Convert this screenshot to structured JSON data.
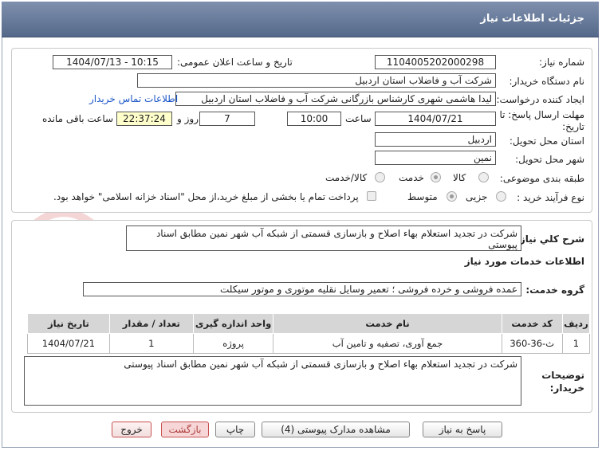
{
  "header": {
    "title": "جزئیات اطلاعات نیاز"
  },
  "form": {
    "need_number_label": "شماره نیاز:",
    "need_number": "1104005202000298",
    "announce_label": "تاریخ و ساعت اعلان عمومی:",
    "announce_value": "1404/07/13 - 10:15",
    "buyer_org_label": "نام دستگاه خریدار:",
    "buyer_org": "شرکت آب و فاضلاب استان اردبیل",
    "creator_label": "ایجاد کننده درخواست:",
    "creator": "لیدا  هاشمی شهری کارشناس بازرگانی شرکت آب و فاضلاب استان اردبیل",
    "contact_link": "اطلاعات تماس خریدار",
    "deadline_label_1": "مهلت ارسال پاسخ: تا",
    "deadline_label_2": "تاریخ:",
    "deadline_date": "1404/07/21",
    "time_label": "ساعت",
    "deadline_time": "10:00",
    "days_value": "7",
    "days_label": "روز و",
    "remaining_time": "22:37:24",
    "remaining_label": "ساعت باقی مانده",
    "province_label": "استان محل تحویل:",
    "province": "اردبیل",
    "city_label": "شهر محل تحویل:",
    "city": "نمین",
    "category_label": "طبقه بندی موضوعی:",
    "category_options": [
      "کالا",
      "خدمت",
      "کالا/خدمت"
    ],
    "category_selected": "خدمت",
    "process_label": "نوع فرآیند خرید :",
    "process_options": [
      "جزیی",
      "متوسط"
    ],
    "process_selected": "متوسط",
    "payment_note": "پرداخت تمام یا بخشی از مبلغ خرید،از محل \"اسناد خزانه اسلامی\" خواهد بود."
  },
  "summary": {
    "label": "شرح کلي نياز:",
    "text": "شرکت در تجدید استعلام بهاء اصلاح و بازسازی قسمتی از شبکه آب شهر نمین مطابق اسناد پیوستی"
  },
  "services": {
    "section_title": "اطلاعات خدمات مورد نیاز",
    "group_label": "گروه خدمت:",
    "group_value": "عمده فروشی و خرده فروشی ؛ تعمیر وسایل نقلیه موتوری و موتور سیکلت",
    "columns": [
      "ردیف",
      "کد خدمت",
      "نام خدمت",
      "واحد اندازه گیری",
      "تعداد / مقدار",
      "تاریخ نیاز"
    ],
    "rows": [
      [
        "1",
        "ث-36-360",
        "جمع آوری، تصفیه و تامین آب",
        "پروژه",
        "1",
        "1404/07/21"
      ]
    ]
  },
  "buyer_notes": {
    "label_1": "توضیحات",
    "label_2": "خریدار:",
    "text": "شرکت در تجدید استعلام بهاء اصلاح و بازسازی قسمتی از شبکه آب شهر نمین مطابق اسناد پیوستی"
  },
  "buttons": {
    "reply": "پاسخ به نیاز",
    "attachments": "مشاهده مدارک پیوستی (4)",
    "print": "چاپ",
    "back": "بازگشت",
    "exit": "خروج"
  },
  "watermark": {
    "text": "AriaTender.neT"
  },
  "colors": {
    "header_bg": "#6a7d9e",
    "link": "#1a55c8",
    "yellow_field": "#ffffcc",
    "table_header": "#d6d6d6",
    "exit_border": "#c85050"
  }
}
